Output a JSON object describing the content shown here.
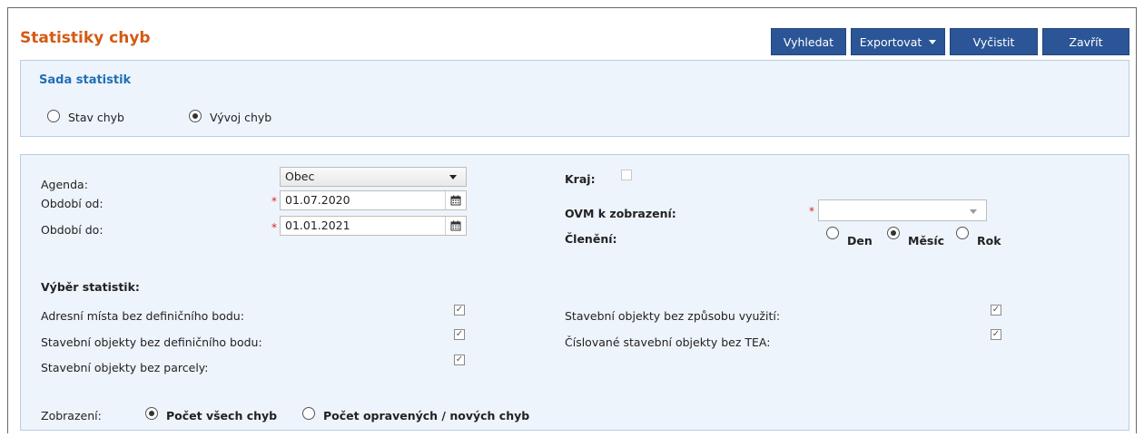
{
  "page": {
    "title": "Statistiky chyb"
  },
  "toolbar": {
    "search_label": "Vyhledat",
    "export_label": "Exportovat",
    "clear_label": "Vyčistit",
    "close_label": "Zavřít"
  },
  "stat_set": {
    "heading": "Sada statistik",
    "options": [
      {
        "label": "Stav chyb",
        "checked": false
      },
      {
        "label": "Vývoj chyb",
        "checked": true
      }
    ]
  },
  "filters": {
    "agenda_label": "Agenda:",
    "agenda_value": "Obec",
    "period_from_label": "Období od:",
    "period_from_value": "01.07.2020",
    "period_to_label": "Období do:",
    "period_to_value": "01.01.2021",
    "required_mark": "*",
    "region_label": "Kraj:",
    "ovm_label": "OVM k zobrazení:",
    "ovm_value": "",
    "breakdown_label": "Členění:",
    "breakdown_options": [
      {
        "label": "Den",
        "checked": false
      },
      {
        "label": "Měsíc",
        "checked": true
      },
      {
        "label": "Rok",
        "checked": false
      }
    ]
  },
  "statistics": {
    "heading": "Výběr statistik:",
    "left": [
      {
        "label": "Adresní místa bez definičního bodu:",
        "checked": true
      },
      {
        "label": "Stavební objekty bez definičního bodu:",
        "checked": true
      },
      {
        "label": "Stavební objekty bez parcely:",
        "checked": true
      }
    ],
    "right": [
      {
        "label": "Stavební objekty bez způsobu využití:",
        "checked": true
      },
      {
        "label": "Číslované stavební objekty bez TEA:",
        "checked": true
      }
    ]
  },
  "display": {
    "label": "Zobrazení:",
    "options": [
      {
        "label": "Počet všech chyb",
        "checked": true
      },
      {
        "label": "Počet opravených / nových chyb",
        "checked": false
      }
    ]
  },
  "colors": {
    "accent": "#d45a14",
    "button": "#2b5596",
    "panel": "#eef4fb",
    "heading": "#1f6fb5"
  },
  "icons": {
    "calendar": "calendar-icon",
    "check": "check-icon",
    "dropdown": "chevron-down-icon"
  }
}
